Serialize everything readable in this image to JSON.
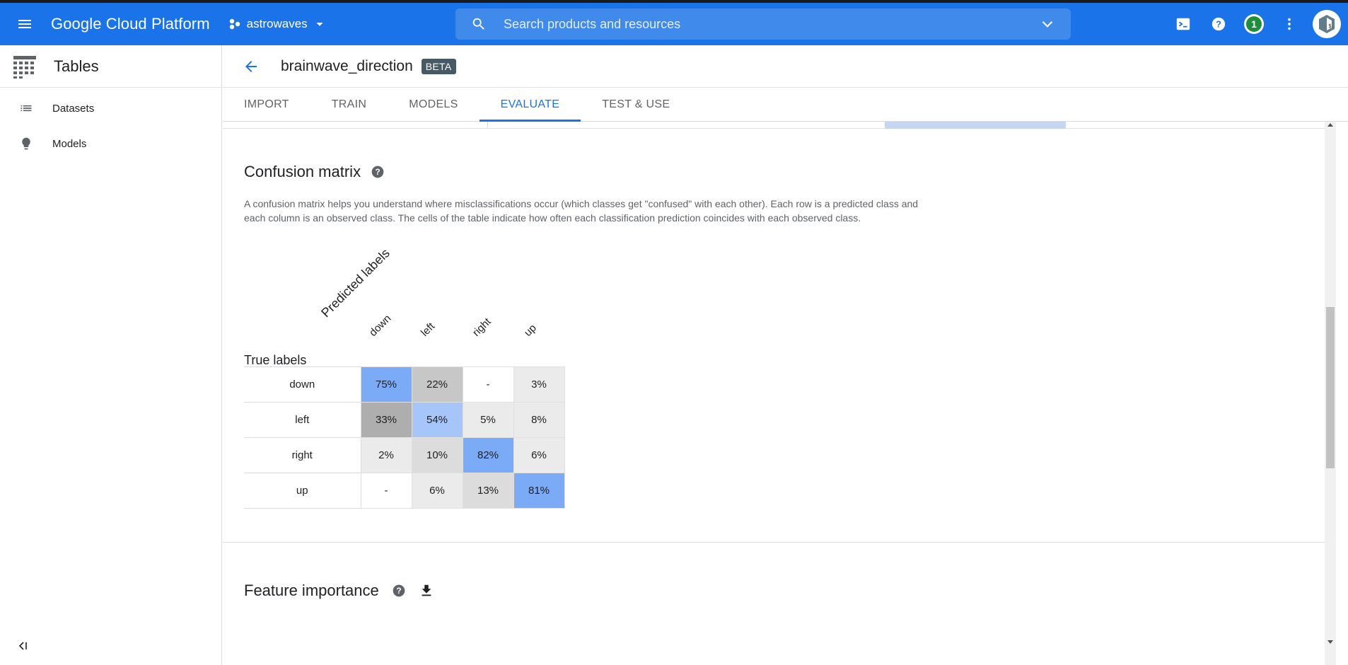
{
  "header": {
    "brand": "Google Cloud Platform",
    "project": "astrowaves",
    "search_placeholder": "Search products and resources",
    "notification_count": "1"
  },
  "sidebar": {
    "title": "Tables",
    "items": [
      {
        "label": "Datasets",
        "icon": "list-icon"
      },
      {
        "label": "Models",
        "icon": "lightbulb-icon"
      }
    ]
  },
  "model": {
    "name": "brainwave_direction",
    "badge": "BETA"
  },
  "tabs": [
    {
      "label": "IMPORT",
      "active": false
    },
    {
      "label": "TRAIN",
      "active": false
    },
    {
      "label": "MODELS",
      "active": false
    },
    {
      "label": "EVALUATE",
      "active": true
    },
    {
      "label": "TEST & USE",
      "active": false
    }
  ],
  "confusion_matrix": {
    "title": "Confusion matrix",
    "description": "A confusion matrix helps you understand where misclassifications occur (which classes get \"confused\" with each other). Each row is a predicted class and each column is an observed class. The cells of the table indicate how often each classification prediction coincides with each observed class.",
    "true_labels_title": "True labels",
    "predicted_labels_title": "Predicted labels",
    "columns": [
      "down",
      "left",
      "right",
      "up"
    ],
    "rows": [
      {
        "label": "down",
        "cells": [
          "75%",
          "22%",
          "-",
          "3%"
        ]
      },
      {
        "label": "left",
        "cells": [
          "33%",
          "54%",
          "5%",
          "8%"
        ]
      },
      {
        "label": "right",
        "cells": [
          "2%",
          "10%",
          "82%",
          "6%"
        ]
      },
      {
        "label": "up",
        "cells": [
          "-",
          "6%",
          "13%",
          "81%"
        ]
      }
    ],
    "colors": {
      "diag_high": "#7baaf7",
      "diag_mid": "#a6c6fa",
      "off_dark": "#aeaeae",
      "off_mid": "#c7c7c7",
      "off_light": "#dcdcdc",
      "off_lighter": "#ebebeb"
    }
  },
  "feature_importance": {
    "title": "Feature importance"
  },
  "colors": {
    "primary": "#1a73e8",
    "badge": "#455a64"
  }
}
